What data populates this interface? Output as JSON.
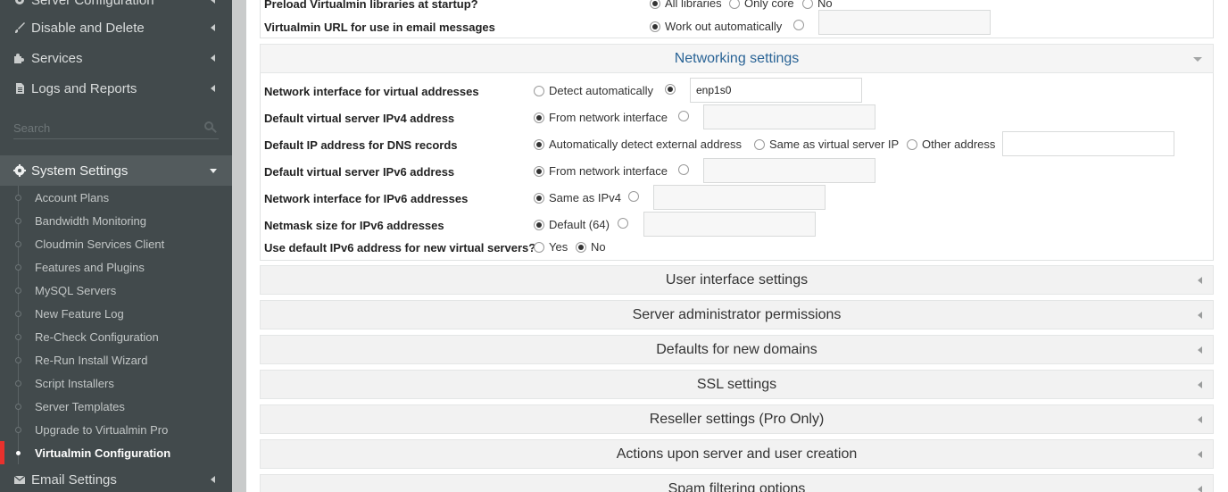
{
  "sidebar": {
    "top_items": [
      {
        "label": "Server Configuration",
        "icon": "gear-icon"
      },
      {
        "label": "Disable and Delete",
        "icon": "brush-icon"
      },
      {
        "label": "Services",
        "icon": "puzzle-icon"
      },
      {
        "label": "Logs and Reports",
        "icon": "document-icon"
      }
    ],
    "search_placeholder": "Search",
    "system_settings": {
      "label": "System Settings",
      "icon": "cog-icon"
    },
    "sub_items": [
      "Account Plans",
      "Bandwidth Monitoring",
      "Cloudmin Services Client",
      "Features and Plugins",
      "MySQL Servers",
      "New Feature Log",
      "Re-Check Configuration",
      "Re-Run Install Wizard",
      "Script Installers",
      "Server Templates",
      "Upgrade to Virtualmin Pro",
      "Virtualmin Configuration"
    ],
    "email_settings": {
      "label": "Email Settings",
      "icon": "envelope-icon"
    }
  },
  "top_panel": {
    "preload_label": "Preload Virtualmin libraries at startup?",
    "preload_opts": [
      "All libraries",
      "Only core",
      "No"
    ],
    "url_label": "Virtualmin URL for use in email messages",
    "url_opt": "Work out automatically",
    "url_value": ""
  },
  "networking": {
    "title": "Networking settings",
    "rows": [
      {
        "label": "Network interface for virtual addresses",
        "opt1": "Detect automatically",
        "value": "enp1s0"
      },
      {
        "label": "Default virtual server IPv4 address",
        "opt1": "From network interface",
        "value": ""
      },
      {
        "label": "Default IP address for DNS records",
        "opt1": "Automatically detect external address",
        "opt2": "Same as virtual server IP",
        "opt3": "Other address",
        "value": ""
      },
      {
        "label": "Default virtual server IPv6 address",
        "opt1": "From network interface",
        "value": ""
      },
      {
        "label": "Network interface for IPv6 addresses",
        "opt1": "Same as IPv4",
        "value": ""
      },
      {
        "label": "Netmask size for IPv6 addresses",
        "opt1": "Default (64)",
        "value": ""
      },
      {
        "label": "Use default IPv6 address for new virtual servers?",
        "opt1": "Yes",
        "opt2": "No"
      }
    ]
  },
  "sections": [
    "User interface settings",
    "Server administrator permissions",
    "Defaults for new domains",
    "SSL settings",
    "Reseller settings (Pro Only)",
    "Actions upon server and user creation",
    "Spam filtering options"
  ]
}
